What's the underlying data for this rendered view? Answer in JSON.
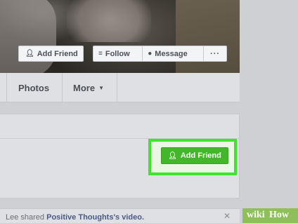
{
  "cover": {
    "add_friend_label": "Add Friend",
    "follow_label": "Follow",
    "message_label": "Message",
    "more_label": "···"
  },
  "tabs": [
    {
      "label": "Photos"
    },
    {
      "label": "More"
    }
  ],
  "action": {
    "add_friend_label": "Add Friend",
    "button_color": "#42b72a",
    "highlight_color": "#3ee62b"
  },
  "post_preview": {
    "text_prefix": "Lee shared ",
    "link_text": "Positive Thoughts's video."
  },
  "watermark": {
    "part1": "wiki",
    "part2": "How"
  },
  "icons": {
    "add_friend": "add-person-icon",
    "follow": "rss-icon",
    "message": "messenger-icon",
    "more": "ellipsis-icon",
    "caret": "caret-down-icon",
    "close": "close-icon"
  }
}
